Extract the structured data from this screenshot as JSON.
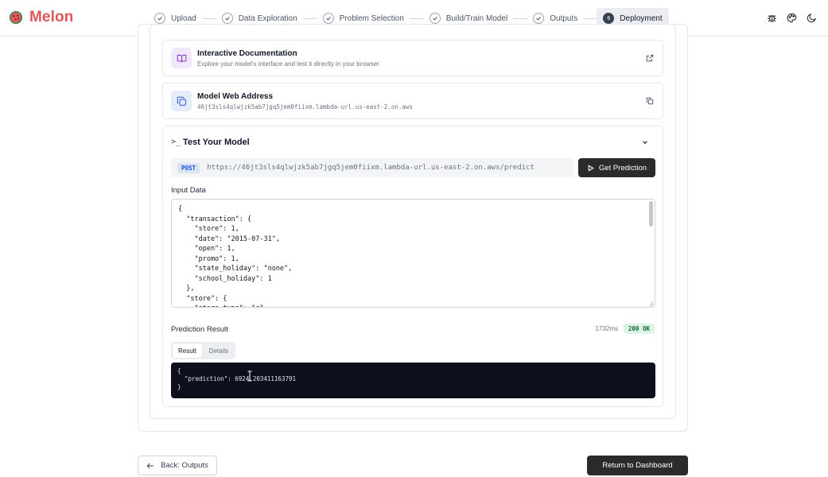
{
  "app": {
    "name": "Melon"
  },
  "steps": [
    {
      "label": "Upload",
      "state": "done"
    },
    {
      "label": "Data Exploration",
      "state": "done"
    },
    {
      "label": "Problem Selection",
      "state": "done"
    },
    {
      "label": "Build/Train Model",
      "state": "done"
    },
    {
      "label": "Outputs",
      "state": "done"
    },
    {
      "label": "Deployment",
      "state": "active",
      "number": "6"
    }
  ],
  "header_icons": [
    "bug-icon",
    "palette-icon",
    "moon-icon"
  ],
  "docs": {
    "title": "Interactive Documentation",
    "subtitle": "Explore your model's interface and test it directly in your browser"
  },
  "address": {
    "title": "Model Web Address",
    "value": "46jt3sls4qlwjzk5ab7jgq5jem0fiixm.lambda-url.us-east-2.on.aws"
  },
  "test": {
    "title": "Test Your Model",
    "method": "POST",
    "url": "https://46jt3sls4qlwjzk5ab7jgq5jem0fiixm.lambda-url.us-east-2.on.aws/predict",
    "predict_label": "Get Prediction",
    "input_label": "Input Data",
    "input_json": "{\n  \"transaction\": {\n    \"store\": 1,\n    \"date\": \"2015-07-31\",\n    \"open\": 1,\n    \"promo\": 1,\n    \"state_holiday\": \"none\",\n    \"school_holiday\": 1\n  },\n  \"store\": {\n    \"store_type\": \"c\",",
    "result_label": "Prediction Result",
    "timing": "1732ms",
    "status": "200 OK",
    "tabs": [
      {
        "label": "Result",
        "active": true
      },
      {
        "label": "Details",
        "active": false
      }
    ],
    "result_json": "{\n  \"prediction\": 6924.203411163791\n}"
  },
  "footer": {
    "back_label": "Back: Outputs",
    "dashboard_label": "Return to Dashboard"
  },
  "colors": {
    "brand": "#e0565b",
    "primary_button": "#2b2b2b",
    "result_bg": "#0d0f1d",
    "status_ok_bg": "#dcf5e4",
    "status_ok_text": "#166534"
  }
}
